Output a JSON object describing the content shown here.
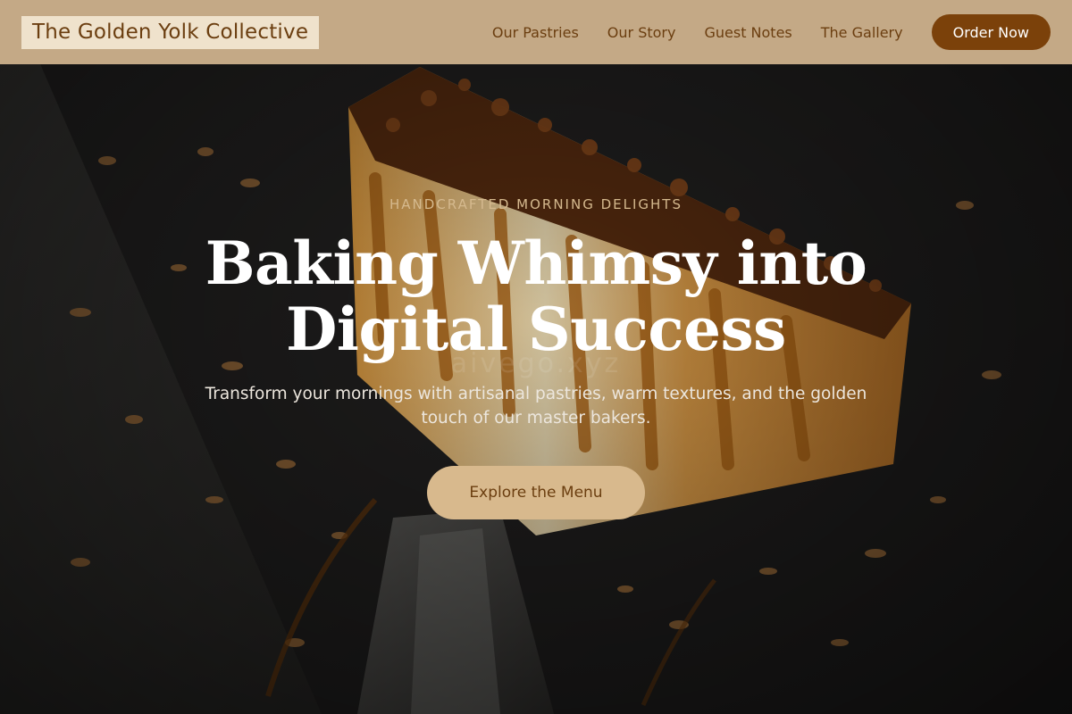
{
  "nav": {
    "brand": "The Golden Yolk Collective",
    "links": [
      "Our Pastries",
      "Our Story",
      "Guest Notes",
      "The Gallery"
    ],
    "order_label": "Order Now"
  },
  "hero": {
    "eyebrow": "HANDCRAFTED MORNING DELIGHTS",
    "headline_line1": "Baking Whimsy into",
    "headline_line2": "Digital Success",
    "subhead_line1": "Transform your mornings with artisanal pastries, warm textures, and the golden",
    "subhead_line2": "touch of our master bakers.",
    "cta_label": "Explore the Menu",
    "watermark": "aivego.xyz"
  },
  "colors": {
    "nav_bg": "#c4a986",
    "brand_bg": "#efe2cc",
    "brand_text": "#6b3e10",
    "order_button": "#7b410a",
    "cta_button": "#d8b98d",
    "eyebrow_text": "#d5b98e"
  }
}
